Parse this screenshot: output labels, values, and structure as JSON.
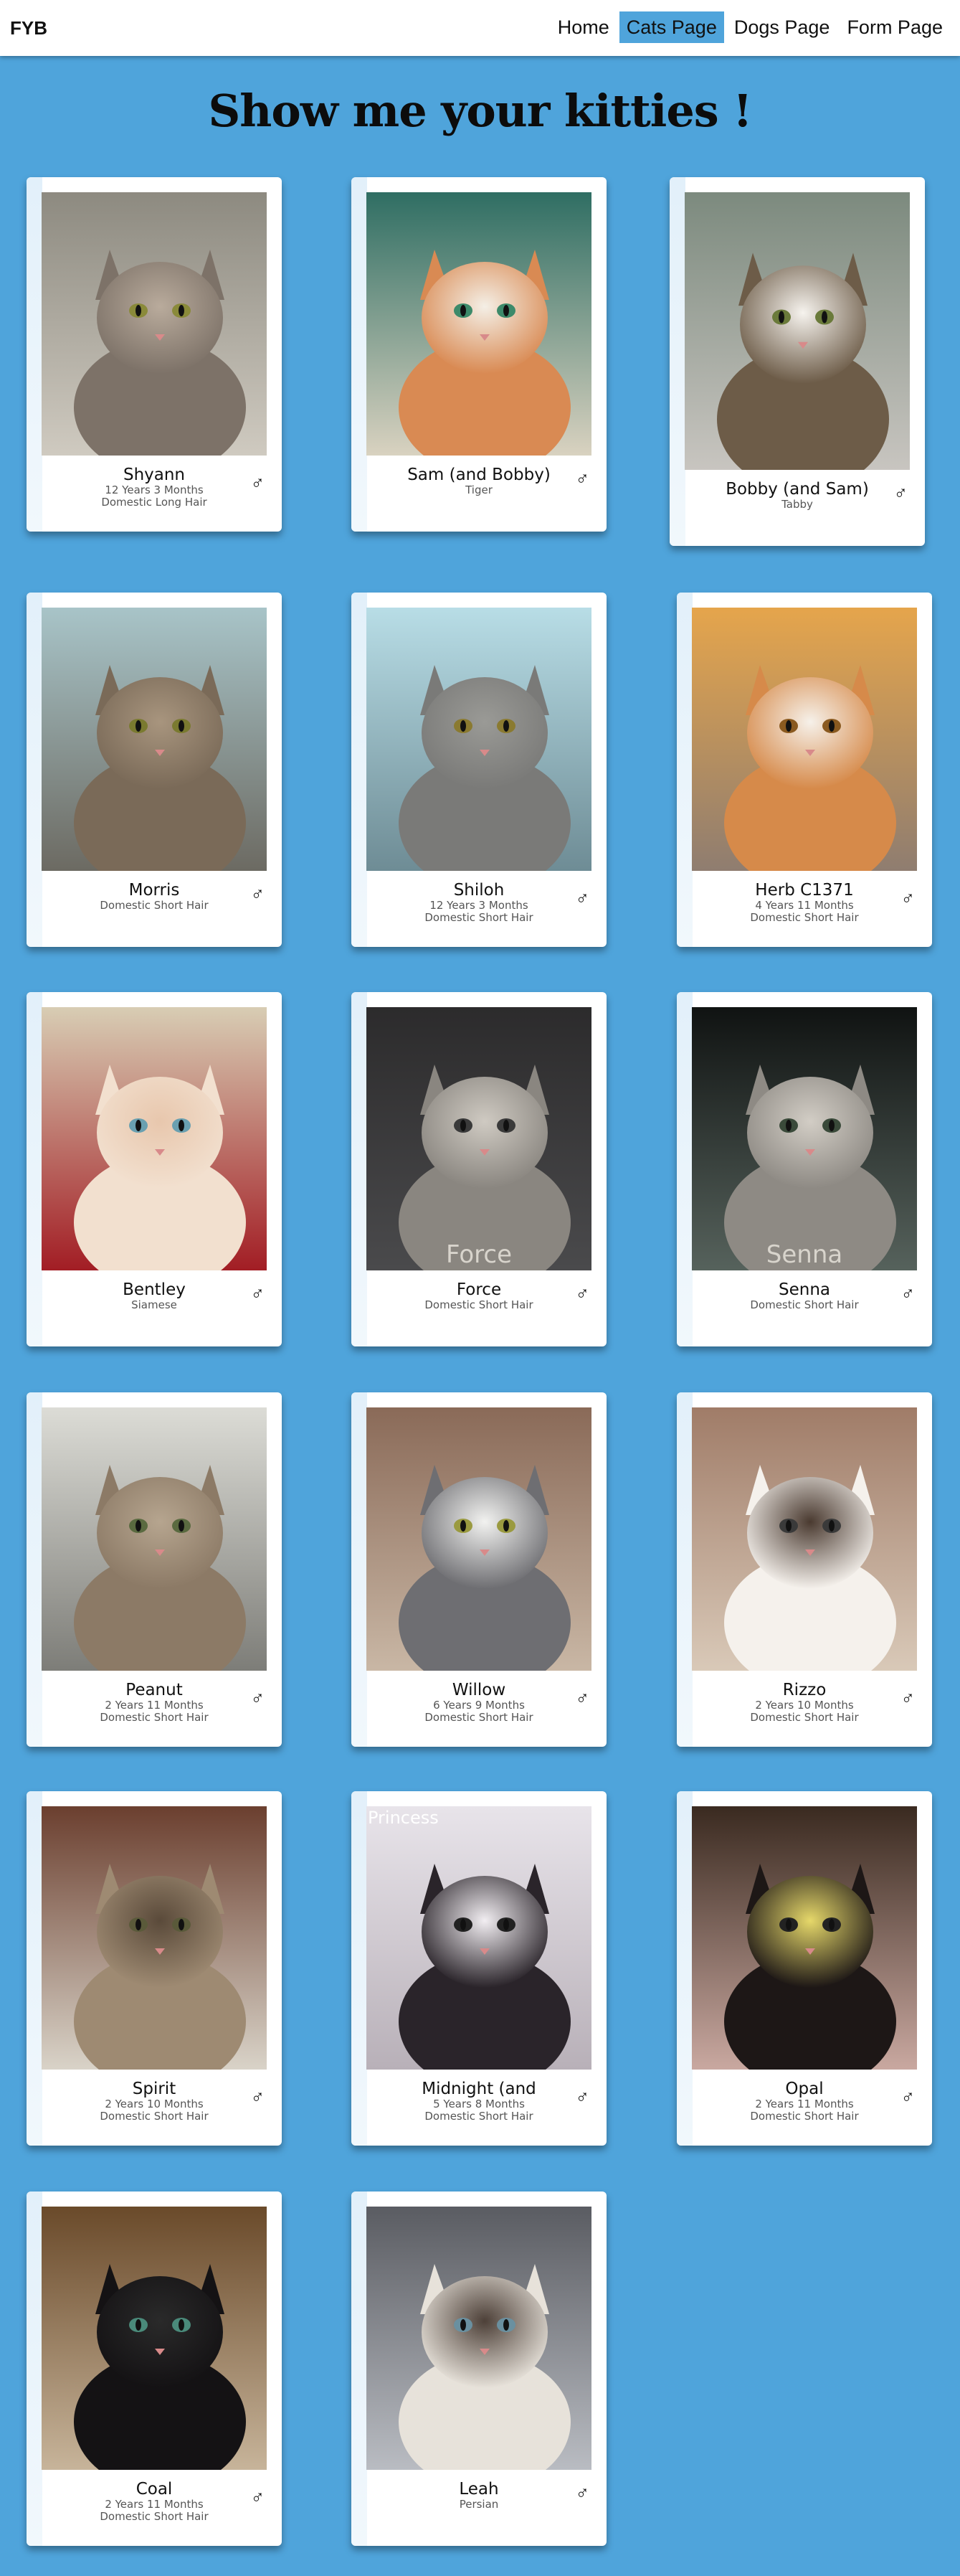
{
  "nav": {
    "brand": "FYB",
    "links": [
      "Home",
      "Cats Page",
      "Dogs Page",
      "Form Page"
    ],
    "active": "Cats Page"
  },
  "page": {
    "title": "Show me your kitties !"
  },
  "colors": {
    "background": "#4fa4db",
    "card": "#ffffff",
    "active_nav": "#4fa4db"
  },
  "cats": [
    {
      "name": "Shyann",
      "age": "12 Years 3 Months",
      "breed": "Domestic Long Hair",
      "gender": "♂"
    },
    {
      "name": "Sam (and Bobby)",
      "age": "",
      "breed": "Tiger",
      "gender": "♂"
    },
    {
      "name": "Bobby (and Sam)",
      "age": "",
      "breed": "Tabby",
      "gender": "♂"
    },
    {
      "name": "Morris",
      "age": "",
      "breed": "Domestic Short Hair",
      "gender": "♂"
    },
    {
      "name": "Shiloh",
      "age": "12 Years 3 Months",
      "breed": "Domestic Short Hair",
      "gender": "♂"
    },
    {
      "name": "Herb C1371",
      "age": "4 Years 11 Months",
      "breed": "Domestic Short Hair",
      "gender": "♂"
    },
    {
      "name": "Bentley",
      "age": "",
      "breed": "Siamese",
      "gender": "♂"
    },
    {
      "name": "Force",
      "age": "",
      "breed": "Domestic Short Hair",
      "gender": "♂",
      "photo_caption": "Force"
    },
    {
      "name": "Senna",
      "age": "",
      "breed": "Domestic Short Hair",
      "gender": "♂",
      "photo_caption": "Senna"
    },
    {
      "name": "Peanut",
      "age": "2 Years 11 Months",
      "breed": "Domestic Short Hair",
      "gender": "♂"
    },
    {
      "name": "Willow",
      "age": "6 Years 9 Months",
      "breed": "Domestic Short Hair",
      "gender": "♂"
    },
    {
      "name": "Rizzo",
      "age": "2 Years 10 Months",
      "breed": "Domestic Short Hair",
      "gender": "♂"
    },
    {
      "name": "Spirit",
      "age": "2 Years 10 Months",
      "breed": "Domestic Short Hair",
      "gender": "♂"
    },
    {
      "name": "Midnight (and",
      "age": "5 Years 8 Months",
      "breed": "Domestic Short Hair",
      "gender": "♂",
      "photo_caption": "Princess"
    },
    {
      "name": "Opal",
      "age": "2 Years 11 Months",
      "breed": "Domestic Short Hair",
      "gender": "♂"
    },
    {
      "name": "Coal",
      "age": "2 Years 11 Months",
      "breed": "Domestic Short Hair",
      "gender": "♂"
    },
    {
      "name": "Leah",
      "age": "",
      "breed": "Persian",
      "gender": "♂"
    }
  ]
}
